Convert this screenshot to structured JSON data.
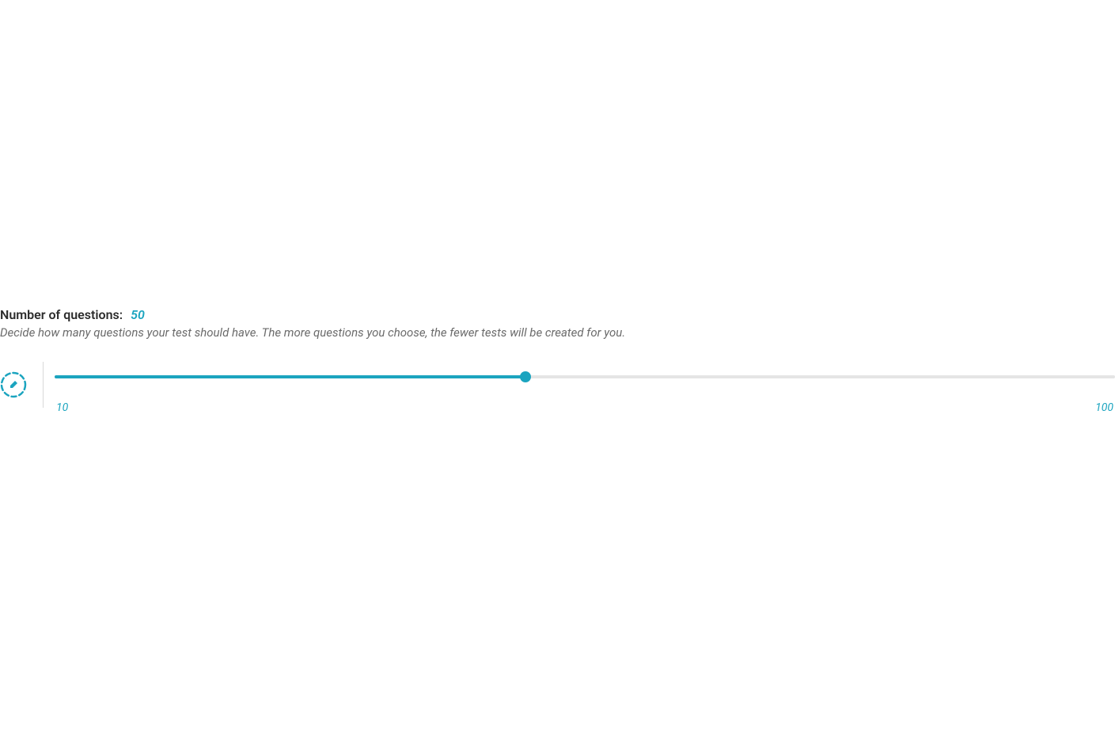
{
  "questions": {
    "label": "Number of questions:",
    "value": "50",
    "description": "Decide how many questions your test should have. The more questions you choose, the fewer tests will be created for you.",
    "slider": {
      "min": "10",
      "max": "100",
      "current": 50
    }
  },
  "colors": {
    "accent": "#1ba4bf"
  }
}
